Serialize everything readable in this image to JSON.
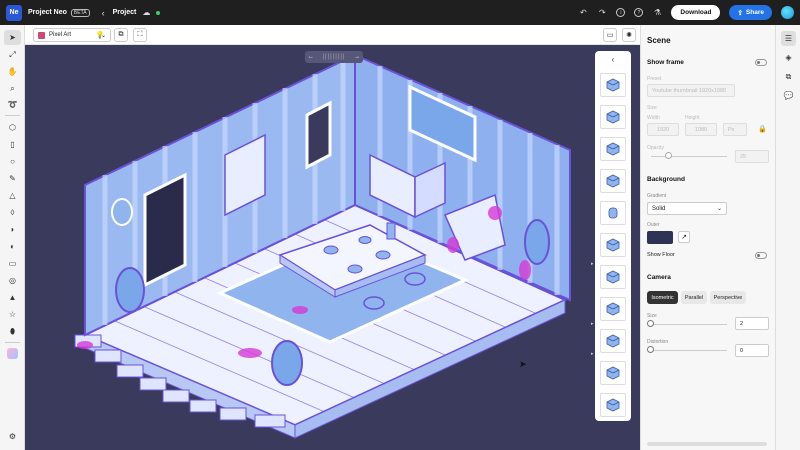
{
  "app": {
    "name": "Project Neo",
    "logo": "Ne",
    "badge": "BETA",
    "project": "Project"
  },
  "topbar": {
    "download": "Download",
    "share": "Share"
  },
  "options": {
    "preset": "Pixel Art"
  },
  "zoom": {
    "prev": "←",
    "next": "→"
  },
  "panel": {
    "title": "Scene",
    "show_frame": "Show frame",
    "preset_label": "Preset",
    "preset_value": "Youtube thumbnail 1920x1080",
    "size_label": "Size",
    "width_label": "Width",
    "height_label": "Height",
    "width_value": "1920",
    "height_value": "1080",
    "unit": "Px",
    "opacity_label": "Opacity",
    "opacity_value": "25",
    "background": "Background",
    "gradient_label": "Gradient",
    "gradient_value": "Solid",
    "outer_label": "Outer",
    "outer_color": "#2e3354",
    "show_floor": "Show Floor",
    "camera": "Camera",
    "camera_modes": [
      "Isometric",
      "Parallel",
      "Perspective"
    ],
    "size2_label": "Size",
    "size2_value": "2",
    "distortion_label": "Distortion",
    "distortion_value": "0"
  },
  "colors": {
    "canvas": "#3a3a5c",
    "accent": "#2473e6",
    "wall": "#8fb4ee",
    "floor": "#f4f6ff",
    "magenta": "#d63ad6"
  }
}
